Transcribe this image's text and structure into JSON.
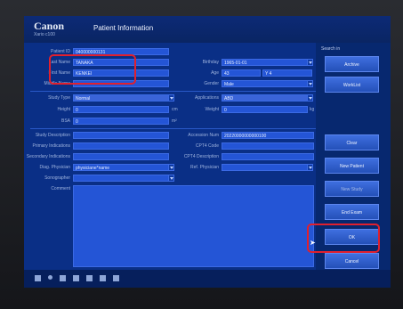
{
  "app": {
    "brand": "Canon",
    "model": "Xario c100",
    "window_title": "Patient Information"
  },
  "patient": {
    "id_label": "Patient ID",
    "id_value": "040000000131",
    "last_name_label": "Last Name",
    "last_name_value": "TANAKA",
    "first_name_label": "First Name",
    "first_name_value": "KENKEI",
    "middle_name_label": "Middle Name",
    "birthday_label": "Birthday",
    "birthday_value": "1965-01-01",
    "age_label": "Age",
    "age_value": "43",
    "age_extra": "Y 4",
    "gender_label": "Gender",
    "gender_value": "Male"
  },
  "study": {
    "type_label": "Study Type",
    "type_value": "Normal",
    "applications_label": "Applications",
    "applications_value": "ABD",
    "height_label": "Height",
    "height_value": "0",
    "height_unit": "cm",
    "weight_label": "Weight",
    "weight_value": "0",
    "weight_unit": "kg",
    "bsa_label": "BSA",
    "bsa_value": "0",
    "bsa_unit": "m²",
    "description_label": "Study Description",
    "accession_label": "Accession Num",
    "accession_value": "20220000000000100",
    "primary_label": "Primary Indications",
    "cpt4_label": "CPT4 Code",
    "secondary_label": "Secondary Indications",
    "cpt4_desc_label": "CPT4 Description",
    "diag_label": "Diag. Physician",
    "diag_value": "physiciane*name",
    "ref_label": "Ref. Physician",
    "sonographer_label": "Sonographer",
    "comment_label": "Comment"
  },
  "sidebar": {
    "search_label": "Search in",
    "buttons": [
      "Archive",
      "WorkList",
      "Clear",
      "New Patient",
      "New Study",
      "End Exam",
      "OK",
      "Cancel"
    ]
  }
}
